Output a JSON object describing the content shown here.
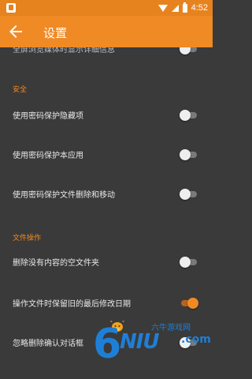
{
  "status_bar": {
    "time": "4:52",
    "icons": [
      "app-notification-icon",
      "wifi-icon",
      "signal-icon",
      "battery-icon"
    ]
  },
  "app_bar": {
    "title": "设置",
    "back_icon": "back-arrow-icon"
  },
  "colors": {
    "accent": "#f08a24",
    "status_bar": "#e6831f",
    "background": "#3a3a3a",
    "switch_off_track": "#7a7a7a",
    "switch_off_thumb": "#eeeeee",
    "watermark": "#1e7fd6"
  },
  "settings": {
    "top_partial": {
      "label": "全屏浏览媒体时显示详细信息",
      "enabled": false
    },
    "security": {
      "header": "安全",
      "items": [
        {
          "label": "使用密码保护隐藏项",
          "enabled": false
        },
        {
          "label": "使用密码保护本应用",
          "enabled": false
        },
        {
          "label": "使用密码保护文件删除和移动",
          "enabled": false
        }
      ]
    },
    "file_ops": {
      "header": "文件操作",
      "items": [
        {
          "label": "删除没有内容的空文件夹",
          "enabled": false
        },
        {
          "label": "操作文件时保留旧的最后修改日期",
          "enabled": true
        },
        {
          "label": "忽略删除确认对话框",
          "enabled": false
        }
      ]
    }
  },
  "watermark": {
    "number": "6",
    "brand": "NIU",
    "suffix": ".com",
    "chinese": "六牛游戏网"
  }
}
